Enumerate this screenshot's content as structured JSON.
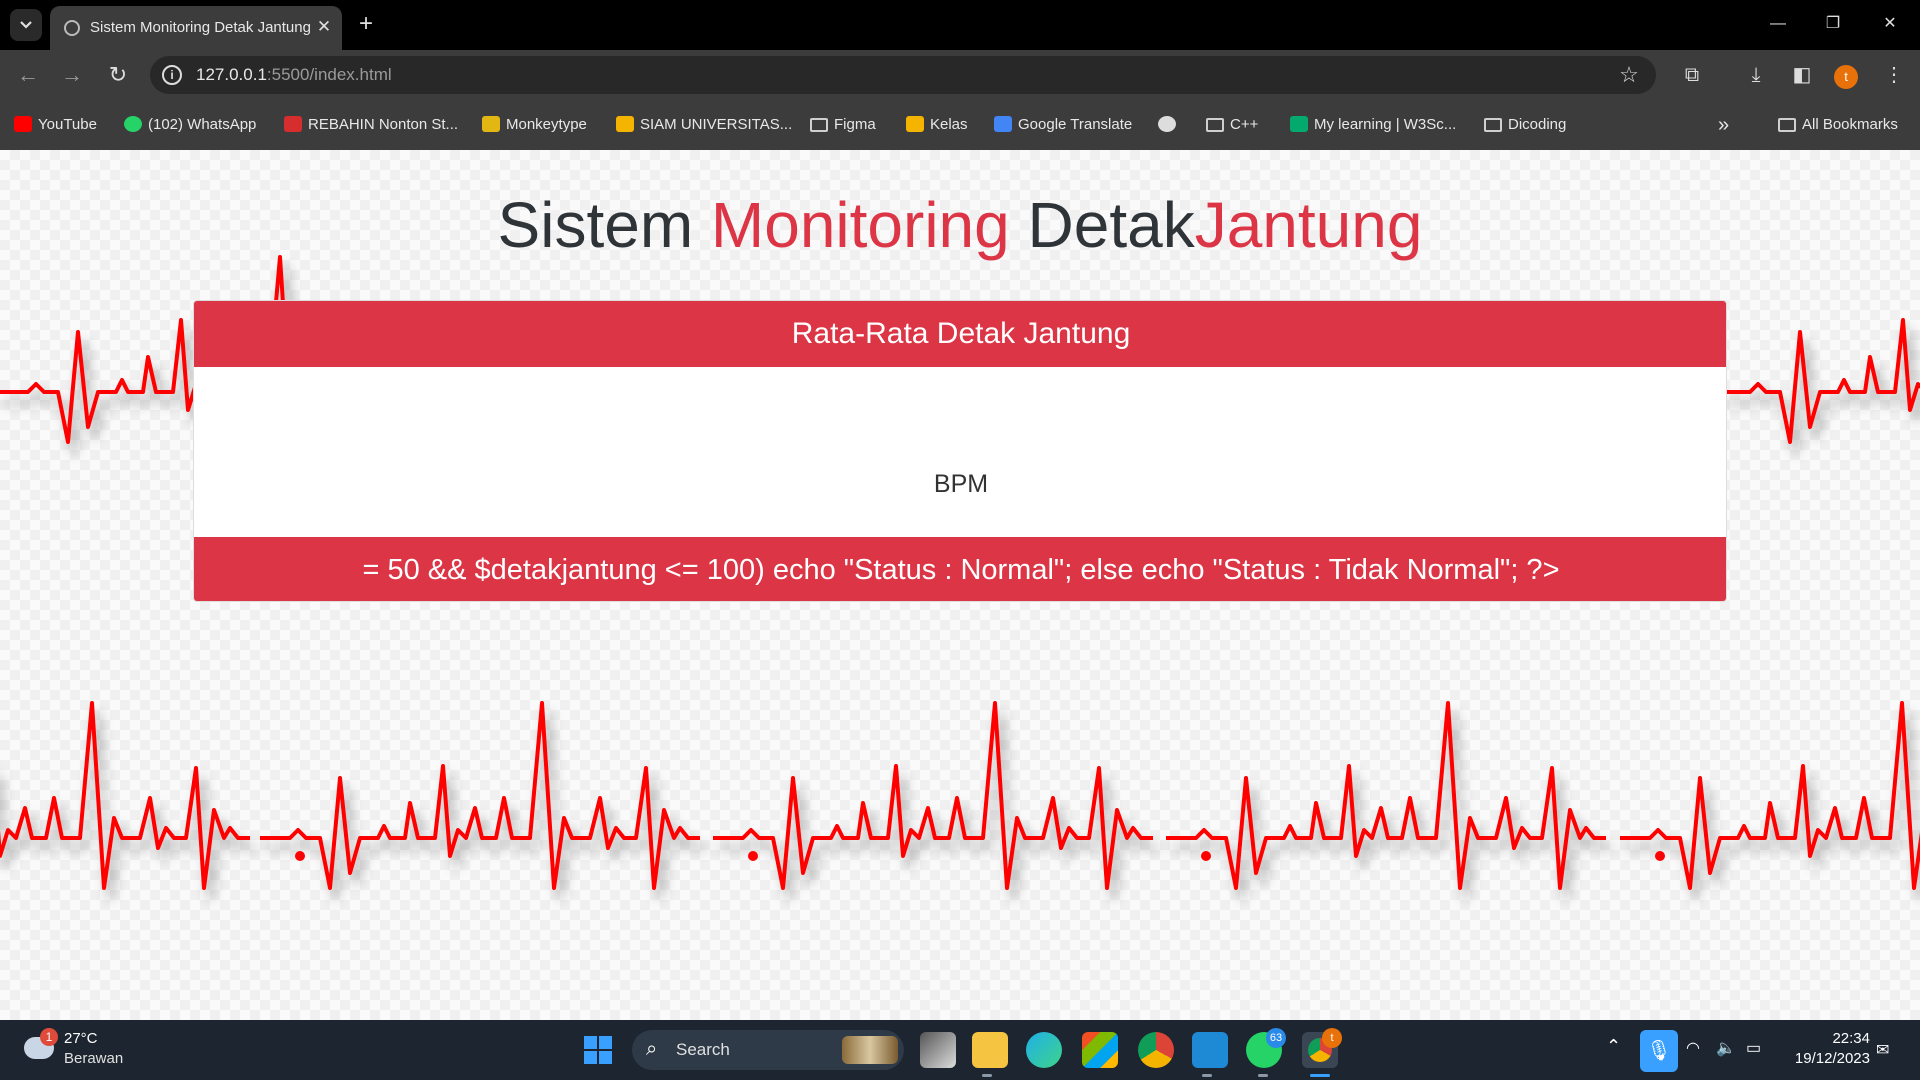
{
  "browser": {
    "tab_title": "Sistem Monitoring Detak Jantung",
    "tab_close": "✕",
    "new_tab": "+",
    "window_controls": {
      "minimize": "—",
      "restore": "❐",
      "close": "✕"
    },
    "url_host": "127.0.0.1",
    "url_rest": ":5500/index.html",
    "bookmarks": [
      {
        "label": "YouTube",
        "icon": "youtube-icon",
        "color": "#ff0000"
      },
      {
        "label": "(102) WhatsApp",
        "icon": "whatsapp-icon",
        "color": "#25d366"
      },
      {
        "label": "REBAHIN Nonton St...",
        "icon": "rebahin-icon",
        "color": "#d62e2e"
      },
      {
        "label": "Monkeytype",
        "icon": "monkeytype-icon",
        "color": "#e2b714"
      },
      {
        "label": "SIAM UNIVERSITAS...",
        "icon": "siam-icon",
        "color": "#f4b400"
      },
      {
        "label": "Figma",
        "icon": "folder-icon",
        "color": ""
      },
      {
        "label": "Kelas",
        "icon": "classroom-icon",
        "color": "#f4b400"
      },
      {
        "label": "Google Translate",
        "icon": "google-translate-icon",
        "color": "#4285f4"
      },
      {
        "label": "",
        "icon": "globe-icon",
        "color": "#dddddd"
      },
      {
        "label": "C++",
        "icon": "folder-icon",
        "color": ""
      },
      {
        "label": "My learning | W3Sc...",
        "icon": "w3schools-icon",
        "color": "#04aa6d"
      },
      {
        "label": "Dicoding",
        "icon": "folder-icon",
        "color": ""
      }
    ],
    "more_bookmarks": "»",
    "all_bookmarks": "All Bookmarks",
    "avatar_letter": "t"
  },
  "page": {
    "heading_1": "Sistem",
    "heading_2": "Monitoring",
    "heading_3": "Detak",
    "heading_4": "Jantung",
    "card_header": "Rata-Rata Detak Jantung",
    "bpm_label": "BPM",
    "card_footer": "= 50 && $detakjantung <= 100) echo \"Status : Normal\"; else echo \"Status : Tidak Normal\"; ?>",
    "accent_color": "#dc3545",
    "ecg_color": "#ff0000"
  },
  "taskbar": {
    "weather_badge": "1",
    "weather_temp": "27°C",
    "weather_desc": "Berawan",
    "search_label": "Search",
    "whatsapp_badge": "63",
    "chrome_badge": "t",
    "time": "22:34",
    "date": "19/12/2023"
  }
}
